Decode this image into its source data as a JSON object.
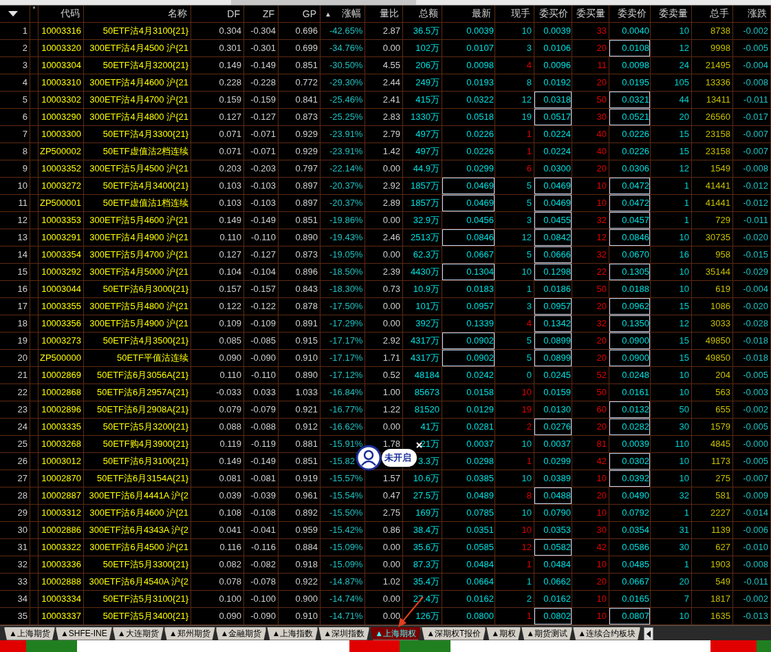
{
  "columns": [
    {
      "kind": "menu"
    },
    {
      "label": "*",
      "kind": "text"
    },
    {
      "label": "代码",
      "kind": "text"
    },
    {
      "label": "名称",
      "kind": "text"
    },
    {
      "label": "DF",
      "kind": "text"
    },
    {
      "label": "ZF",
      "kind": "text"
    },
    {
      "label": "GP",
      "kind": "text"
    },
    {
      "label": "涨幅",
      "kind": "sorted",
      "sort_mark": "▲"
    },
    {
      "label": "量比",
      "kind": "text"
    },
    {
      "label": "总额",
      "kind": "text"
    },
    {
      "label": "最新",
      "kind": "text"
    },
    {
      "label": "现手",
      "kind": "text"
    },
    {
      "label": "委买价",
      "kind": "text"
    },
    {
      "label": "委买量",
      "kind": "text"
    },
    {
      "label": "委卖价",
      "kind": "text"
    },
    {
      "label": "委卖量",
      "kind": "text"
    },
    {
      "label": "总手",
      "kind": "text"
    },
    {
      "label": "涨跌",
      "kind": "text"
    }
  ],
  "rows": [
    {
      "no": "1",
      "code": "10003316",
      "name": "50ETF沽4月3100{21}",
      "df": "0.304",
      "zf": "-0.304",
      "gp": "0.696",
      "change_pct": "-42.65%",
      "volume_ratio": "2.87",
      "turnover": "36.5万",
      "last": "0.0039",
      "current_volume": "10",
      "uptick": false,
      "bid": "0.0039",
      "bid_volume": "33",
      "ask": "0.0040",
      "ask_volume": "10",
      "total_volume": "8738",
      "change": "-0.002",
      "last_boxed": false,
      "bid_boxed": false,
      "ask_boxed": false
    },
    {
      "no": "2",
      "code": "10003320",
      "name": "300ETF沽4月4500 沪{21",
      "df": "0.301",
      "zf": "-0.301",
      "gp": "0.699",
      "change_pct": "-34.76%",
      "volume_ratio": "0.00",
      "turnover": "102万",
      "last": "0.0107",
      "current_volume": "3",
      "uptick": false,
      "bid": "0.0106",
      "bid_volume": "20",
      "ask": "0.0108",
      "ask_volume": "12",
      "total_volume": "9998",
      "change": "-0.005",
      "last_boxed": false,
      "bid_boxed": false,
      "ask_boxed": true
    },
    {
      "no": "3",
      "code": "10003304",
      "name": "50ETF沽4月3200{21}",
      "df": "0.149",
      "zf": "-0.149",
      "gp": "0.851",
      "change_pct": "-30.50%",
      "volume_ratio": "4.55",
      "turnover": "206万",
      "last": "0.0098",
      "current_volume": "4",
      "uptick": true,
      "bid": "0.0096",
      "bid_volume": "11",
      "ask": "0.0098",
      "ask_volume": "24",
      "total_volume": "21495",
      "change": "-0.004",
      "last_boxed": false,
      "bid_boxed": false,
      "ask_boxed": false
    },
    {
      "no": "4",
      "code": "10003310",
      "name": "300ETF沽4月4600 沪{21",
      "df": "0.228",
      "zf": "-0.228",
      "gp": "0.772",
      "change_pct": "-29.30%",
      "volume_ratio": "2.44",
      "turnover": "249万",
      "last": "0.0193",
      "current_volume": "8",
      "uptick": false,
      "bid": "0.0192",
      "bid_volume": "20",
      "ask": "0.0195",
      "ask_volume": "105",
      "total_volume": "13336",
      "change": "-0.008",
      "last_boxed": false,
      "bid_boxed": false,
      "ask_boxed": false
    },
    {
      "no": "5",
      "code": "10003302",
      "name": "300ETF沽4月4700 沪{21",
      "df": "0.159",
      "zf": "-0.159",
      "gp": "0.841",
      "change_pct": "-25.46%",
      "volume_ratio": "2.41",
      "turnover": "415万",
      "last": "0.0322",
      "current_volume": "12",
      "uptick": false,
      "bid": "0.0318",
      "bid_volume": "50",
      "ask": "0.0321",
      "ask_volume": "44",
      "total_volume": "13411",
      "change": "-0.011",
      "last_boxed": false,
      "bid_boxed": true,
      "ask_boxed": true
    },
    {
      "no": "6",
      "code": "10003290",
      "name": "300ETF沽4月4800 沪{21",
      "df": "0.127",
      "zf": "-0.127",
      "gp": "0.873",
      "change_pct": "-25.25%",
      "volume_ratio": "2.83",
      "turnover": "1330万",
      "last": "0.0518",
      "current_volume": "19",
      "uptick": false,
      "bid": "0.0517",
      "bid_volume": "30",
      "ask": "0.0521",
      "ask_volume": "20",
      "total_volume": "26560",
      "change": "-0.017",
      "last_boxed": false,
      "bid_boxed": true,
      "ask_boxed": true
    },
    {
      "no": "7",
      "code": "10003300",
      "name": "50ETF沽4月3300{21}",
      "df": "0.071",
      "zf": "-0.071",
      "gp": "0.929",
      "change_pct": "-23.91%",
      "volume_ratio": "2.79",
      "turnover": "497万",
      "last": "0.0226",
      "current_volume": "1",
      "uptick": true,
      "bid": "0.0224",
      "bid_volume": "40",
      "ask": "0.0226",
      "ask_volume": "15",
      "total_volume": "23158",
      "change": "-0.007",
      "last_boxed": false,
      "bid_boxed": false,
      "ask_boxed": false
    },
    {
      "no": "8",
      "code": "ZP500002",
      "name": "50ETF虚值沽2档连续",
      "df": "0.071",
      "zf": "-0.071",
      "gp": "0.929",
      "change_pct": "-23.91%",
      "volume_ratio": "1.42",
      "turnover": "497万",
      "last": "0.0226",
      "current_volume": "1",
      "uptick": true,
      "bid": "0.0224",
      "bid_volume": "40",
      "ask": "0.0226",
      "ask_volume": "15",
      "total_volume": "23158",
      "change": "-0.007",
      "last_boxed": false,
      "bid_boxed": false,
      "ask_boxed": false
    },
    {
      "no": "9",
      "code": "10003352",
      "name": "300ETF沽5月4500 沪{21",
      "df": "0.203",
      "zf": "-0.203",
      "gp": "0.797",
      "change_pct": "-22.14%",
      "volume_ratio": "0.00",
      "turnover": "44.9万",
      "last": "0.0299",
      "current_volume": "6",
      "uptick": true,
      "bid": "0.0300",
      "bid_volume": "20",
      "ask": "0.0306",
      "ask_volume": "12",
      "total_volume": "1549",
      "change": "-0.008",
      "last_boxed": false,
      "bid_boxed": false,
      "ask_boxed": false
    },
    {
      "no": "10",
      "code": "10003272",
      "name": "50ETF沽4月3400{21}",
      "df": "0.103",
      "zf": "-0.103",
      "gp": "0.897",
      "change_pct": "-20.37%",
      "volume_ratio": "2.92",
      "turnover": "1857万",
      "last": "0.0469",
      "current_volume": "5",
      "uptick": false,
      "bid": "0.0469",
      "bid_volume": "10",
      "ask": "0.0472",
      "ask_volume": "1",
      "total_volume": "41441",
      "change": "-0.012",
      "last_boxed": true,
      "bid_boxed": true,
      "ask_boxed": true
    },
    {
      "no": "11",
      "code": "ZP500001",
      "name": "50ETF虚值沽1档连续",
      "df": "0.103",
      "zf": "-0.103",
      "gp": "0.897",
      "change_pct": "-20.37%",
      "volume_ratio": "2.89",
      "turnover": "1857万",
      "last": "0.0469",
      "current_volume": "5",
      "uptick": false,
      "bid": "0.0469",
      "bid_volume": "10",
      "ask": "0.0472",
      "ask_volume": "1",
      "total_volume": "41441",
      "change": "-0.012",
      "last_boxed": true,
      "bid_boxed": true,
      "ask_boxed": true
    },
    {
      "no": "12",
      "code": "10003353",
      "name": "300ETF沽5月4600 沪{21",
      "df": "0.149",
      "zf": "-0.149",
      "gp": "0.851",
      "change_pct": "-19.86%",
      "volume_ratio": "0.00",
      "turnover": "32.9万",
      "last": "0.0456",
      "current_volume": "3",
      "uptick": false,
      "bid": "0.0455",
      "bid_volume": "32",
      "ask": "0.0457",
      "ask_volume": "1",
      "total_volume": "729",
      "change": "-0.011",
      "last_boxed": false,
      "bid_boxed": true,
      "ask_boxed": true
    },
    {
      "no": "13",
      "code": "10003291",
      "name": "300ETF沽4月4900 沪{21",
      "df": "0.110",
      "zf": "-0.110",
      "gp": "0.890",
      "change_pct": "-19.43%",
      "volume_ratio": "2.46",
      "turnover": "2513万",
      "last": "0.0846",
      "current_volume": "12",
      "uptick": false,
      "bid": "0.0842",
      "bid_volume": "12",
      "ask": "0.0846",
      "ask_volume": "10",
      "total_volume": "30735",
      "change": "-0.020",
      "last_boxed": true,
      "bid_boxed": true,
      "ask_boxed": true
    },
    {
      "no": "14",
      "code": "10003354",
      "name": "300ETF沽5月4700 沪{21",
      "df": "0.127",
      "zf": "-0.127",
      "gp": "0.873",
      "change_pct": "-19.05%",
      "volume_ratio": "0.00",
      "turnover": "62.3万",
      "last": "0.0667",
      "current_volume": "5",
      "uptick": false,
      "bid": "0.0666",
      "bid_volume": "32",
      "ask": "0.0670",
      "ask_volume": "16",
      "total_volume": "958",
      "change": "-0.015",
      "last_boxed": false,
      "bid_boxed": true,
      "ask_boxed": false
    },
    {
      "no": "15",
      "code": "10003292",
      "name": "300ETF沽4月5000 沪{21",
      "df": "0.104",
      "zf": "-0.104",
      "gp": "0.896",
      "change_pct": "-18.50%",
      "volume_ratio": "2.39",
      "turnover": "4430万",
      "last": "0.1304",
      "current_volume": "10",
      "uptick": false,
      "bid": "0.1298",
      "bid_volume": "22",
      "ask": "0.1305",
      "ask_volume": "10",
      "total_volume": "35144",
      "change": "-0.029",
      "last_boxed": true,
      "bid_boxed": true,
      "ask_boxed": true
    },
    {
      "no": "16",
      "code": "10003044",
      "name": "50ETF沽6月3000{21}",
      "df": "0.157",
      "zf": "-0.157",
      "gp": "0.843",
      "change_pct": "-18.30%",
      "volume_ratio": "0.73",
      "turnover": "10.9万",
      "last": "0.0183",
      "current_volume": "1",
      "uptick": false,
      "bid": "0.0186",
      "bid_volume": "50",
      "ask": "0.0188",
      "ask_volume": "10",
      "total_volume": "619",
      "change": "-0.004",
      "last_boxed": false,
      "bid_boxed": false,
      "ask_boxed": false
    },
    {
      "no": "17",
      "code": "10003355",
      "name": "300ETF沽5月4800 沪{21",
      "df": "0.122",
      "zf": "-0.122",
      "gp": "0.878",
      "change_pct": "-17.50%",
      "volume_ratio": "0.00",
      "turnover": "101万",
      "last": "0.0957",
      "current_volume": "3",
      "uptick": false,
      "bid": "0.0957",
      "bid_volume": "20",
      "ask": "0.0962",
      "ask_volume": "15",
      "total_volume": "1086",
      "change": "-0.020",
      "last_boxed": false,
      "bid_boxed": true,
      "ask_boxed": true
    },
    {
      "no": "18",
      "code": "10003356",
      "name": "300ETF沽5月4900 沪{21",
      "df": "0.109",
      "zf": "-0.109",
      "gp": "0.891",
      "change_pct": "-17.29%",
      "volume_ratio": "0.00",
      "turnover": "392万",
      "last": "0.1339",
      "current_volume": "4",
      "uptick": true,
      "bid": "0.1342",
      "bid_volume": "32",
      "ask": "0.1350",
      "ask_volume": "12",
      "total_volume": "3033",
      "change": "-0.028",
      "last_boxed": false,
      "bid_boxed": true,
      "ask_boxed": true
    },
    {
      "no": "19",
      "code": "10003273",
      "name": "50ETF沽4月3500{21}",
      "df": "0.085",
      "zf": "-0.085",
      "gp": "0.915",
      "change_pct": "-17.17%",
      "volume_ratio": "2.92",
      "turnover": "4317万",
      "last": "0.0902",
      "current_volume": "5",
      "uptick": false,
      "bid": "0.0899",
      "bid_volume": "20",
      "ask": "0.0900",
      "ask_volume": "15",
      "total_volume": "49850",
      "change": "-0.018",
      "last_boxed": true,
      "bid_boxed": true,
      "ask_boxed": true
    },
    {
      "no": "20",
      "code": "ZP500000",
      "name": "50ETF平值沽连续",
      "df": "0.090",
      "zf": "-0.090",
      "gp": "0.910",
      "change_pct": "-17.17%",
      "volume_ratio": "1.71",
      "turnover": "4317万",
      "last": "0.0902",
      "current_volume": "5",
      "uptick": false,
      "bid": "0.0899",
      "bid_volume": "20",
      "ask": "0.0900",
      "ask_volume": "15",
      "total_volume": "49850",
      "change": "-0.018",
      "last_boxed": true,
      "bid_boxed": true,
      "ask_boxed": true
    },
    {
      "no": "21",
      "code": "10002869",
      "name": "50ETF沽6月3056A{21}",
      "df": "0.110",
      "zf": "-0.110",
      "gp": "0.890",
      "change_pct": "-17.12%",
      "volume_ratio": "0.52",
      "turnover": "48184",
      "last": "0.0242",
      "current_volume": "0",
      "uptick": false,
      "bid": "0.0245",
      "bid_volume": "52",
      "ask": "0.0248",
      "ask_volume": "10",
      "total_volume": "204",
      "change": "-0.005",
      "last_boxed": false,
      "bid_boxed": false,
      "ask_boxed": false
    },
    {
      "no": "22",
      "code": "10002868",
      "name": "50ETF沽6月2957A{21}",
      "df": "-0.033",
      "zf": "0.033",
      "gp": "1.033",
      "change_pct": "-16.84%",
      "volume_ratio": "1.00",
      "turnover": "85673",
      "last": "0.0158",
      "current_volume": "10",
      "uptick": true,
      "bid": "0.0159",
      "bid_volume": "50",
      "ask": "0.0161",
      "ask_volume": "10",
      "total_volume": "563",
      "change": "-0.003",
      "last_boxed": false,
      "bid_boxed": false,
      "ask_boxed": false
    },
    {
      "no": "23",
      "code": "10002896",
      "name": "50ETF沽6月2908A{21}",
      "df": "0.079",
      "zf": "-0.079",
      "gp": "0.921",
      "change_pct": "-16.77%",
      "volume_ratio": "1.22",
      "turnover": "81520",
      "last": "0.0129",
      "current_volume": "19",
      "uptick": true,
      "bid": "0.0130",
      "bid_volume": "60",
      "ask": "0.0132",
      "ask_volume": "50",
      "total_volume": "655",
      "change": "-0.002",
      "last_boxed": false,
      "bid_boxed": false,
      "ask_boxed": true
    },
    {
      "no": "24",
      "code": "10003335",
      "name": "50ETF沽5月3200{21}",
      "df": "0.088",
      "zf": "-0.088",
      "gp": "0.912",
      "change_pct": "-16.62%",
      "volume_ratio": "0.00",
      "turnover": "41万",
      "last": "0.0281",
      "current_volume": "2",
      "uptick": true,
      "bid": "0.0276",
      "bid_volume": "20",
      "ask": "0.0282",
      "ask_volume": "30",
      "total_volume": "1579",
      "change": "-0.005",
      "last_boxed": false,
      "bid_boxed": true,
      "ask_boxed": true
    },
    {
      "no": "25",
      "code": "10003268",
      "name": "50ETF购4月3900{21}",
      "df": "0.119",
      "zf": "-0.119",
      "gp": "0.881",
      "change_pct": "-15.91%",
      "volume_ratio": "1.78",
      "turnover": "21万",
      "last": "0.0037",
      "current_volume": "10",
      "uptick": false,
      "bid": "0.0037",
      "bid_volume": "81",
      "ask": "0.0039",
      "ask_volume": "110",
      "total_volume": "4845",
      "change": "-0.000",
      "last_boxed": false,
      "bid_boxed": false,
      "ask_boxed": false
    },
    {
      "no": "26",
      "code": "10003012",
      "name": "50ETF沽6月3100{21}",
      "df": "0.149",
      "zf": "-0.149",
      "gp": "0.851",
      "change_pct": "-15.82",
      "turnover": "3.3万",
      "last": "0.0298",
      "current_volume": "1",
      "uptick": true,
      "bid": "0.0299",
      "bid_volume": "42",
      "ask": "0.0302",
      "ask_volume": "10",
      "total_volume": "1173",
      "change": "-0.005",
      "last_boxed": false,
      "bid_boxed": false,
      "ask_boxed": true
    },
    {
      "no": "27",
      "code": "10002870",
      "name": "50ETF沽6月3154A{21}",
      "df": "0.081",
      "zf": "-0.081",
      "gp": "0.919",
      "change_pct": "-15.57%",
      "volume_ratio": "1.57",
      "turnover": "10.6万",
      "last": "0.0385",
      "current_volume": "10",
      "uptick": false,
      "bid": "0.0389",
      "bid_volume": "10",
      "ask": "0.0392",
      "ask_volume": "10",
      "total_volume": "275",
      "change": "-0.007",
      "last_boxed": false,
      "bid_boxed": false,
      "ask_boxed": true
    },
    {
      "no": "28",
      "code": "10002887",
      "name": "300ETF沽6月4441A 沪{2",
      "df": "0.039",
      "zf": "-0.039",
      "gp": "0.961",
      "change_pct": "-15.54%",
      "volume_ratio": "0.47",
      "turnover": "27.5万",
      "last": "0.0489",
      "current_volume": "8",
      "uptick": true,
      "bid": "0.0488",
      "bid_volume": "20",
      "ask": "0.0490",
      "ask_volume": "32",
      "total_volume": "581",
      "change": "-0.009",
      "last_boxed": false,
      "bid_boxed": true,
      "ask_boxed": false
    },
    {
      "no": "29",
      "code": "10003312",
      "name": "300ETF沽6月4600 沪{21",
      "df": "0.108",
      "zf": "-0.108",
      "gp": "0.892",
      "change_pct": "-15.50%",
      "volume_ratio": "2.75",
      "turnover": "169万",
      "last": "0.0785",
      "current_volume": "10",
      "uptick": false,
      "bid": "0.0790",
      "bid_volume": "10",
      "ask": "0.0792",
      "ask_volume": "1",
      "total_volume": "2227",
      "change": "-0.014",
      "last_boxed": false,
      "bid_boxed": false,
      "ask_boxed": false
    },
    {
      "no": "30",
      "code": "10002886",
      "name": "300ETF沽6月4343A 沪{2",
      "df": "0.041",
      "zf": "-0.041",
      "gp": "0.959",
      "change_pct": "-15.42%",
      "volume_ratio": "0.86",
      "turnover": "38.4万",
      "last": "0.0351",
      "current_volume": "10",
      "uptick": true,
      "bid": "0.0353",
      "bid_volume": "30",
      "ask": "0.0354",
      "ask_volume": "31",
      "total_volume": "1139",
      "change": "-0.006",
      "last_boxed": false,
      "bid_boxed": false,
      "ask_boxed": false
    },
    {
      "no": "31",
      "code": "10003322",
      "name": "300ETF沽6月4500 沪{21",
      "df": "0.116",
      "zf": "-0.116",
      "gp": "0.884",
      "change_pct": "-15.09%",
      "volume_ratio": "0.00",
      "turnover": "35.6万",
      "last": "0.0585",
      "current_volume": "12",
      "uptick": true,
      "bid": "0.0582",
      "bid_volume": "42",
      "ask": "0.0586",
      "ask_volume": "30",
      "total_volume": "627",
      "change": "-0.010",
      "last_boxed": false,
      "bid_boxed": true,
      "ask_boxed": false
    },
    {
      "no": "32",
      "code": "10003336",
      "name": "50ETF沽5月3300{21}",
      "df": "0.082",
      "zf": "-0.082",
      "gp": "0.918",
      "change_pct": "-15.09%",
      "volume_ratio": "0.00",
      "turnover": "87.3万",
      "last": "0.0484",
      "current_volume": "1",
      "uptick": true,
      "bid": "0.0484",
      "bid_volume": "10",
      "ask": "0.0485",
      "ask_volume": "1",
      "total_volume": "1903",
      "change": "-0.008",
      "last_boxed": false,
      "bid_boxed": false,
      "ask_boxed": false
    },
    {
      "no": "33",
      "code": "10002888",
      "name": "300ETF沽6月4540A 沪{2",
      "df": "0.078",
      "zf": "-0.078",
      "gp": "0.922",
      "change_pct": "-14.87%",
      "volume_ratio": "1.02",
      "turnover": "35.4万",
      "last": "0.0664",
      "current_volume": "1",
      "uptick": false,
      "bid": "0.0662",
      "bid_volume": "20",
      "ask": "0.0667",
      "ask_volume": "20",
      "total_volume": "549",
      "change": "-0.011",
      "last_boxed": false,
      "bid_boxed": false,
      "ask_boxed": false
    },
    {
      "no": "34",
      "code": "10003334",
      "name": "50ETF沽5月3100{21}",
      "df": "0.100",
      "zf": "-0.100",
      "gp": "0.900",
      "change_pct": "-14.74%",
      "volume_ratio": "0.00",
      "turnover": "27.4万",
      "last": "0.0162",
      "current_volume": "2",
      "uptick": false,
      "bid": "0.0162",
      "bid_volume": "10",
      "ask": "0.0165",
      "ask_volume": "7",
      "total_volume": "1817",
      "change": "-0.002",
      "last_boxed": false,
      "bid_boxed": false,
      "ask_boxed": false
    },
    {
      "no": "35",
      "code": "10003337",
      "name": "50ETF沽5月3400{21}",
      "df": "0.090",
      "zf": "-0.090",
      "gp": "0.910",
      "change_pct": "-14.71%",
      "volume_ratio": "0.00",
      "turnover": "126万",
      "last": "0.0800",
      "current_volume": "1",
      "uptick": true,
      "bid": "0.0802",
      "bid_volume": "10",
      "ask": "0.0807",
      "ask_volume": "10",
      "total_volume": "1635",
      "change": "-0.013",
      "last_boxed": false,
      "bid_boxed": true,
      "ask_boxed": true
    }
  ],
  "badge": {
    "label": "未开启"
  },
  "tabs": [
    {
      "label": "▲上海期货",
      "selected": false
    },
    {
      "label": "▲SHFE-INE",
      "selected": false
    },
    {
      "label": "▲大连期货",
      "selected": false
    },
    {
      "label": "▲郑州期货",
      "selected": false
    },
    {
      "label": "▲金融期货",
      "selected": false
    },
    {
      "label": "▲上海指数",
      "selected": false
    },
    {
      "label": "▲深圳指数",
      "selected": false
    },
    {
      "label": "▲上海期权",
      "selected": true
    },
    {
      "label": "▲深期权T报价",
      "selected": false
    },
    {
      "label": "▲期权",
      "selected": false
    },
    {
      "label": "▲期货测试",
      "selected": false
    },
    {
      "label": "▲连续合约板块",
      "selected": false
    }
  ]
}
